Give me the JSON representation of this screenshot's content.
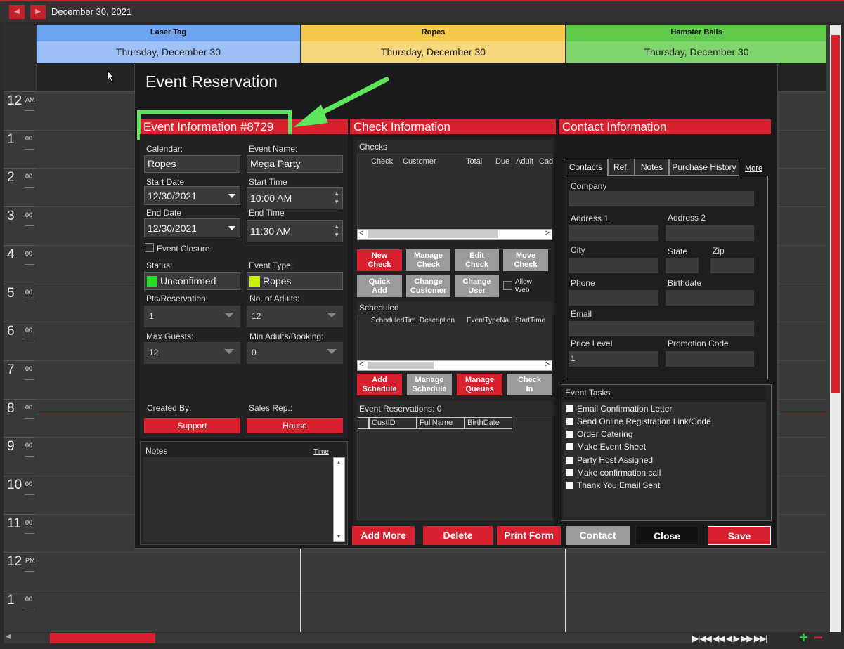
{
  "topbar": {
    "date": "December 30, 2021",
    "prev_icon": "◀",
    "next_icon": "▶"
  },
  "calendar": {
    "columns": [
      {
        "name": "Laser Tag",
        "day": "Thursday, December 30",
        "color": "#6ea3f0"
      },
      {
        "name": "Ropes",
        "day": "Thursday, December 30",
        "color": "#f5c94a"
      },
      {
        "name": "Hamster Balls",
        "day": "Thursday, December 30",
        "color": "#5fc94a"
      }
    ],
    "hours": [
      {
        "h": "12",
        "m": "AM"
      },
      {
        "h": "1",
        "m": "00"
      },
      {
        "h": "2",
        "m": "00"
      },
      {
        "h": "3",
        "m": "00"
      },
      {
        "h": "4",
        "m": "00"
      },
      {
        "h": "5",
        "m": "00"
      },
      {
        "h": "6",
        "m": "00"
      },
      {
        "h": "7",
        "m": "00"
      },
      {
        "h": "8",
        "m": "00"
      },
      {
        "h": "9",
        "m": "00"
      },
      {
        "h": "10",
        "m": "00"
      },
      {
        "h": "11",
        "m": "00"
      },
      {
        "h": "12",
        "m": "PM"
      },
      {
        "h": "1",
        "m": "00"
      }
    ]
  },
  "modal": {
    "title": "Event Reservation",
    "event_info": {
      "header": "Event Information #8729",
      "calendar_label": "Calendar:",
      "calendar_value": "Ropes",
      "event_name_label": "Event Name:",
      "event_name_value": "Mega Party",
      "start_date_label": "Start Date",
      "start_date_value": "12/30/2021",
      "start_time_label": "Start Time",
      "start_time_value": "10:00 AM",
      "end_date_label": "End Date",
      "end_date_value": "12/30/2021",
      "end_time_label": "End Time",
      "end_time_value": "11:30 AM",
      "event_closure_label": "Event Closure",
      "status_label": "Status:",
      "status_value": "Unconfirmed",
      "status_color": "#22dd22",
      "event_type_label": "Event Type:",
      "event_type_value": "Ropes",
      "event_type_color": "#ccee00",
      "pts_label": "Pts/Reservation:",
      "pts_value": "1",
      "adults_label": "No. of Adults:",
      "adults_value": "12",
      "max_guests_label": "Max Guests:",
      "max_guests_value": "12",
      "min_adults_label": "Min Adults/Booking:",
      "min_adults_value": "0",
      "created_by_label": "Created By:",
      "created_by_value": "Support",
      "sales_rep_label": "Sales Rep.:",
      "sales_rep_value": "House",
      "notes_label": "Notes",
      "notes_time_link": "Time"
    },
    "check_info": {
      "header": "Check Information",
      "checks_label": "Checks",
      "checks_columns": [
        "Check",
        "Customer",
        "Total",
        "Due",
        "Adult",
        "Cad"
      ],
      "buttons_row1": [
        "New Check",
        "Manage Check",
        "Edit Check",
        "Move Check"
      ],
      "buttons_row2": [
        "Quick Add",
        "Change Customer",
        "Change User"
      ],
      "allow_web_label": "Allow Web",
      "scheduled_label": "Scheduled",
      "scheduled_columns": [
        "ScheduledTim",
        "Description",
        "EventTypeNa",
        "StartTime"
      ],
      "buttons_row3": [
        "Add Schedule",
        "Manage Schedule",
        "Manage Queues",
        "Check In"
      ],
      "reservations_label": "Event Reservations: 0",
      "reservation_columns": [
        "CustID",
        "FullName",
        "BirthDate"
      ]
    },
    "contact_info": {
      "header": "Contact Information",
      "tabs": [
        "Contacts",
        "Ref.",
        "Notes",
        "Purchase History"
      ],
      "more_link": "More",
      "company_label": "Company",
      "address1_label": "Address 1",
      "address2_label": "Address 2",
      "city_label": "City",
      "state_label": "State",
      "zip_label": "Zip",
      "phone_label": "Phone",
      "birthdate_label": "Birthdate",
      "email_label": "Email",
      "price_level_label": "Price Level",
      "price_level_value": "1",
      "promo_label": "Promotion Code"
    },
    "event_tasks": {
      "header": "Event Tasks",
      "items": [
        "Email Confirmation Letter",
        "Send Online Registration Link/Code",
        "Order Catering",
        "Make Event Sheet",
        "Party Host Assigned",
        "Make confirmation call",
        "Thank You Email Sent"
      ]
    },
    "footer_buttons": [
      "Add More",
      "Delete",
      "Print Form",
      "Contact",
      "Close",
      "Save"
    ]
  },
  "bottombar": {
    "nav_glyphs": "▶|◀◀ ◀◀  ◀   ▶  ▶▶ ▶▶|",
    "add_icon": "+",
    "remove_icon": "−"
  }
}
